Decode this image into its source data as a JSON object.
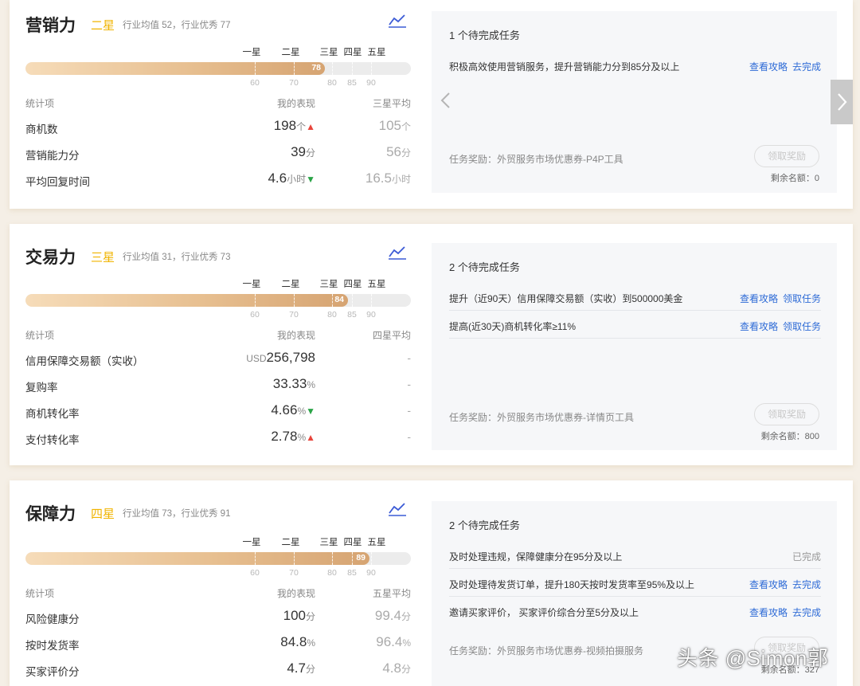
{
  "sections": [
    {
      "title": "营销力",
      "star": "二星",
      "industry": "行业均值 52，行业优秀 77",
      "star_marks": [
        "一星",
        "二星",
        "三星",
        "四星",
        "五星"
      ],
      "score": "78",
      "score_value": 78,
      "ticks": [
        "60",
        "70",
        "80",
        "85",
        "90"
      ],
      "headers": [
        "统计项",
        "我的表现",
        "三星平均"
      ],
      "rows": [
        {
          "label": "商机数",
          "value": "198",
          "unit": "个",
          "trend": "up",
          "avg": "105",
          "avg_unit": "个"
        },
        {
          "label": "营销能力分",
          "value": "39",
          "unit": "分",
          "trend": "",
          "avg": "56",
          "avg_unit": "分"
        },
        {
          "label": "平均回复时间",
          "value": "4.6",
          "unit": "小时",
          "trend": "down",
          "avg": "16.5",
          "avg_unit": "小时"
        }
      ],
      "task_title": "1 个待完成任务",
      "tasks": [
        {
          "text": "积极高效使用营销服务，提升营销能力分到85分及以上",
          "link1": "查看攻略",
          "link2": "去完成"
        }
      ],
      "reward": "任务奖励：外贸服务市场优惠券-P4P工具",
      "claim": "领取奖励",
      "remain": "剩余名额：0"
    },
    {
      "title": "交易力",
      "star": "三星",
      "industry": "行业均值 31，行业优秀 73",
      "star_marks": [
        "一星",
        "二星",
        "三星",
        "四星",
        "五星"
      ],
      "score": "84",
      "score_value": 84,
      "ticks": [
        "60",
        "70",
        "80",
        "85",
        "90"
      ],
      "headers": [
        "统计项",
        "我的表现",
        "四星平均"
      ],
      "rows": [
        {
          "label": "信用保障交易额（实收）",
          "prefix": "USD",
          "value": "256,798",
          "unit": "",
          "trend": "",
          "avg": "-",
          "avg_unit": ""
        },
        {
          "label": "复购率",
          "value": "33.33",
          "unit": "%",
          "trend": "",
          "avg": "-",
          "avg_unit": ""
        },
        {
          "label": "商机转化率",
          "value": "4.66",
          "unit": "%",
          "trend": "down",
          "avg": "-",
          "avg_unit": ""
        },
        {
          "label": "支付转化率",
          "value": "2.78",
          "unit": "%",
          "trend": "up",
          "avg": "-",
          "avg_unit": ""
        }
      ],
      "task_title": "2 个待完成任务",
      "tasks": [
        {
          "text": "提升（近90天）信用保障交易额（实收）到500000美金",
          "link1": "查看攻略",
          "link2": "领取任务"
        },
        {
          "text": "提高(近30天)商机转化率≥11%",
          "link1": "查看攻略",
          "link2": "领取任务"
        }
      ],
      "reward": "任务奖励：外贸服务市场优惠券-详情页工具",
      "claim": "领取奖励",
      "remain": "剩余名额：800"
    },
    {
      "title": "保障力",
      "star": "四星",
      "industry": "行业均值 73，行业优秀 91",
      "star_marks": [
        "一星",
        "二星",
        "三星",
        "四星",
        "五星"
      ],
      "score": "89",
      "score_value": 89,
      "ticks": [
        "60",
        "70",
        "80",
        "85",
        "90"
      ],
      "headers": [
        "统计项",
        "我的表现",
        "五星平均"
      ],
      "rows": [
        {
          "label": "风险健康分",
          "value": "100",
          "unit": "分",
          "trend": "",
          "avg": "99.4",
          "avg_unit": "分"
        },
        {
          "label": "按时发货率",
          "value": "84.8",
          "unit": "%",
          "trend": "",
          "avg": "96.4",
          "avg_unit": "%"
        },
        {
          "label": "买家评价分",
          "value": "4.7",
          "unit": "分",
          "trend": "",
          "avg": "4.8",
          "avg_unit": "分"
        }
      ],
      "task_title": "2 个待完成任务",
      "tasks": [
        {
          "text": "及时处理违规，保障健康分在95分及以上",
          "link1": "",
          "link2": "已完成"
        },
        {
          "text": "及时处理待发货订单，提升180天按时发货率至95%及以上",
          "link1": "查看攻略",
          "link2": "去完成"
        },
        {
          "text": "邀请买家评价， 买家评价综合分至5分及以上",
          "link1": "查看攻略",
          "link2": "去完成"
        }
      ],
      "reward": "任务奖励：外贸服务市场优惠券-视频拍摄服务",
      "claim": "领取奖励",
      "remain": "剩余名额：327"
    }
  ],
  "watermark": "头条 @Simon郭",
  "colors": {
    "star": "#f0b400",
    "link": "#2e6bd6",
    "up": "#e8453c",
    "down": "#2aa447",
    "bar_end": "#d6a472"
  }
}
